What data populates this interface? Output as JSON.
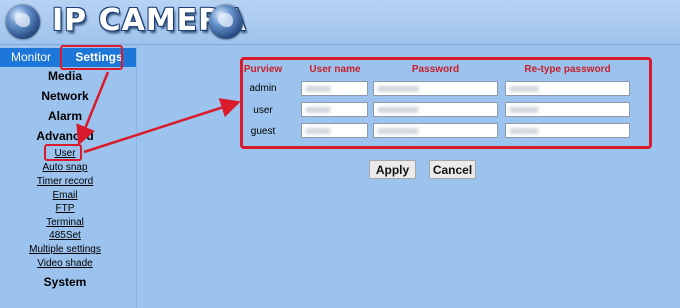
{
  "header": {
    "title": "IP CAMERA",
    "globe_icon": "globe-icon"
  },
  "tabs": {
    "monitor": "Monitor",
    "settings": "Settings"
  },
  "menu": {
    "media": "Media",
    "network": "Network",
    "alarm": "Alarm",
    "advanced": "Advanced",
    "system": "System",
    "submenu": [
      "User",
      "Auto snap",
      "Timer record",
      "Email",
      "FTP",
      "Terminal",
      "485Set",
      "Multiple settings",
      "Video shade"
    ]
  },
  "form": {
    "headers": {
      "purview": "Purview",
      "username": "User name",
      "password": "Password",
      "retype": "Re-type password"
    },
    "rows": [
      {
        "purview": "admin",
        "username": "",
        "password": "",
        "retype": ""
      },
      {
        "purview": "user",
        "username": "",
        "password": "",
        "retype": ""
      },
      {
        "purview": "guest",
        "username": "",
        "password": "",
        "retype": ""
      }
    ]
  },
  "buttons": {
    "apply": "Apply",
    "cancel": "Cancel"
  },
  "colors": {
    "accent_red": "#d91b2b",
    "tab_blue": "#1d77d8",
    "background": "#9cc3ee"
  }
}
